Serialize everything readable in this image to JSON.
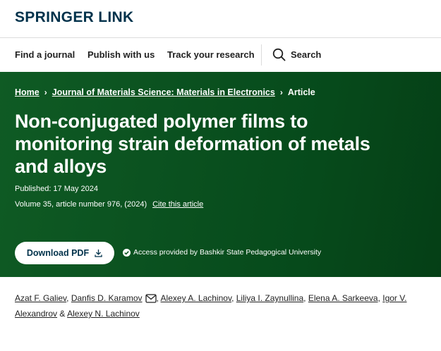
{
  "brand": {
    "logo_text": "SPRINGER LINK",
    "primary_color": "#01324b",
    "hero_color": "#0b5220"
  },
  "nav": {
    "find_journal": "Find a journal",
    "publish": "Publish with us",
    "track": "Track your research",
    "search_label": "Search",
    "search_icon": "search-icon"
  },
  "breadcrumb": {
    "home": "Home",
    "journal": "Journal of Materials Science: Materials in Electronics",
    "current": "Article",
    "separator": "›"
  },
  "article": {
    "title_line1": "Non-conjugated polymer films to",
    "title_line2": "monitoring strain deformation of metals",
    "title_line3": "and alloys",
    "published": "Published: 17 May 2024",
    "volume": "Volume 35, article number 976, (2024)",
    "cite_label": "Cite this article"
  },
  "actions": {
    "download_pdf": "Download PDF",
    "access_text": "Access provided by Bashkir State Pedagogical University"
  },
  "authors": {
    "a1": "Azat F. Galiev",
    "a2": "Danfis D. Karamov",
    "a3": "Alexey A. Lachinov",
    "a4": "Liliya I. Zaynullina",
    "a5": "Elena A. Sarkeeva",
    "a6_part1": "Igor V.",
    "a6_part2": "Alexandrov",
    "a7": "Alexey N. Lachinov",
    "sep_comma": ",",
    "sep_amp": "&"
  }
}
